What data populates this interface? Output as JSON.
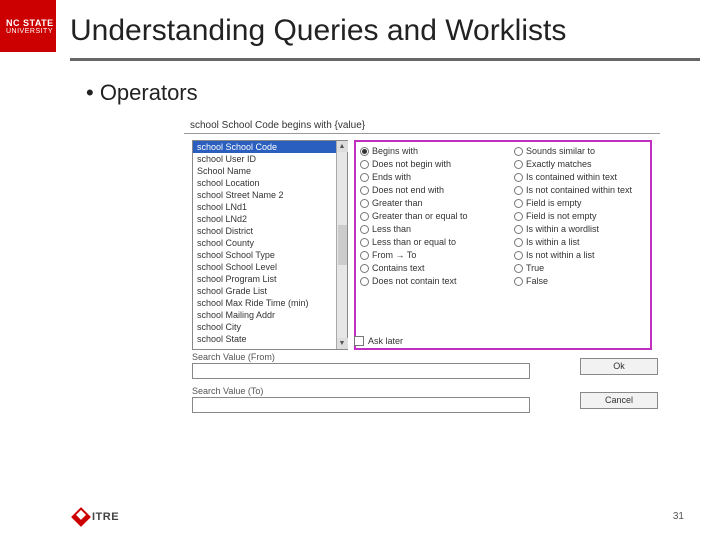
{
  "brand": {
    "line1": "NC STATE",
    "line2": "UNIVERSITY"
  },
  "title": "Understanding Queries and Worklists",
  "bullet": "•  Operators",
  "dialog": {
    "titlebar": "school School Code  begins with {value}",
    "list": {
      "items": [
        "school School Code",
        "school User ID",
        "School Name",
        "school Location",
        "school Street Name 2",
        "school LNd1",
        "school LNd2",
        "school District",
        "school County",
        "school School Type",
        "school School Level",
        "school Program List",
        "school Grade List",
        "school Max Ride Time (min)",
        "school Mailing Addr",
        "school City",
        "school State"
      ],
      "selected_index": 0
    },
    "operators_col1": [
      {
        "label": "Begins with",
        "checked": true
      },
      {
        "label": "Does not begin with",
        "checked": false
      },
      {
        "label": "Ends with",
        "checked": false
      },
      {
        "label": "Does not end with",
        "checked": false
      },
      {
        "label": "Greater than",
        "checked": false
      },
      {
        "label": "Greater than or equal to",
        "checked": false
      },
      {
        "label": "Less than",
        "checked": false
      },
      {
        "label": "Less than or equal to",
        "checked": false
      },
      {
        "label": "From → To",
        "checked": false
      },
      {
        "label": "Contains text",
        "checked": false
      },
      {
        "label": "Does not contain text",
        "checked": false
      }
    ],
    "operators_col2": [
      {
        "label": "Sounds similar to",
        "checked": false
      },
      {
        "label": "Exactly matches",
        "checked": false
      },
      {
        "label": "Is contained within text",
        "checked": false
      },
      {
        "label": "Is not contained within text",
        "checked": false
      },
      {
        "label": "Field is empty",
        "checked": false
      },
      {
        "label": "Field is not empty",
        "checked": false
      },
      {
        "label": "Is within a wordlist",
        "checked": false
      },
      {
        "label": "Is within a list",
        "checked": false
      },
      {
        "label": "Is not within a list",
        "checked": false
      },
      {
        "label": "True",
        "checked": false
      },
      {
        "label": "False",
        "checked": false
      }
    ],
    "ask_later": "Ask later",
    "search_from_label": "Search Value (From)",
    "search_to_label": "Search Value (To)",
    "ok": "Ok",
    "cancel": "Cancel"
  },
  "footer_logo": "ITRE",
  "page_number": "31"
}
